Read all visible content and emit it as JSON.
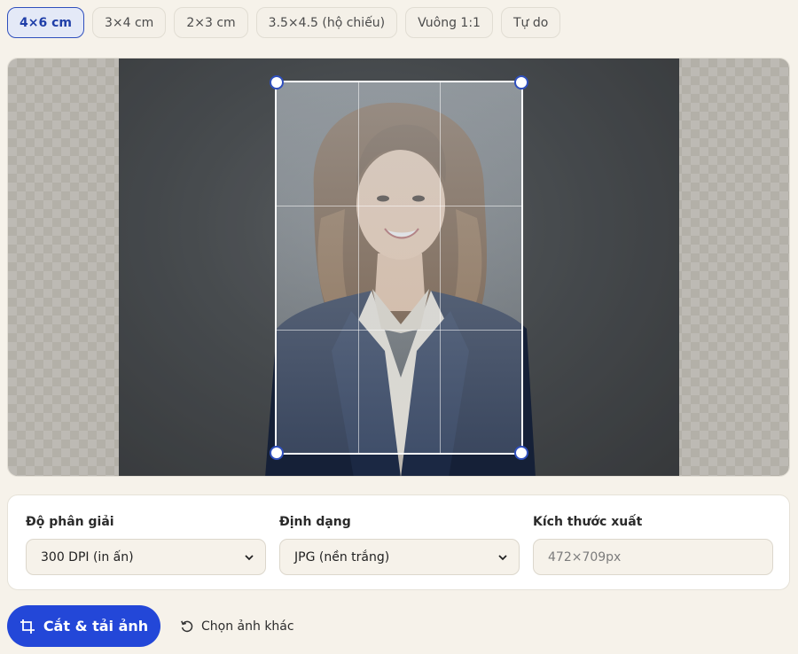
{
  "presets": [
    {
      "label": "4×6 cm",
      "active": true
    },
    {
      "label": "3×4 cm",
      "active": false
    },
    {
      "label": "2×3 cm",
      "active": false
    },
    {
      "label": "3.5×4.5 (hộ chiếu)",
      "active": false
    },
    {
      "label": "Vuông 1:1",
      "active": false
    },
    {
      "label": "Tự do",
      "active": false
    }
  ],
  "settings": {
    "resolution": {
      "label": "Độ phân giải",
      "value": "300 DPI (in ấn)"
    },
    "format": {
      "label": "Định dạng",
      "value": "JPG (nền trắng)"
    },
    "output_size": {
      "label": "Kích thước xuất",
      "placeholder": "472×709px"
    }
  },
  "actions": {
    "crop_download": "Cắt & tải ảnh",
    "choose_other": "Chọn ảnh khác"
  },
  "colors": {
    "accent": "#2347d8",
    "active_preset_bg": "#e4e9f7",
    "page_bg": "#f6f2ea"
  },
  "icons": {
    "crop": "crop-icon",
    "refresh": "rotate-ccw-icon",
    "dropdown": "chevron-down-icon",
    "handle": "crop-handle"
  }
}
